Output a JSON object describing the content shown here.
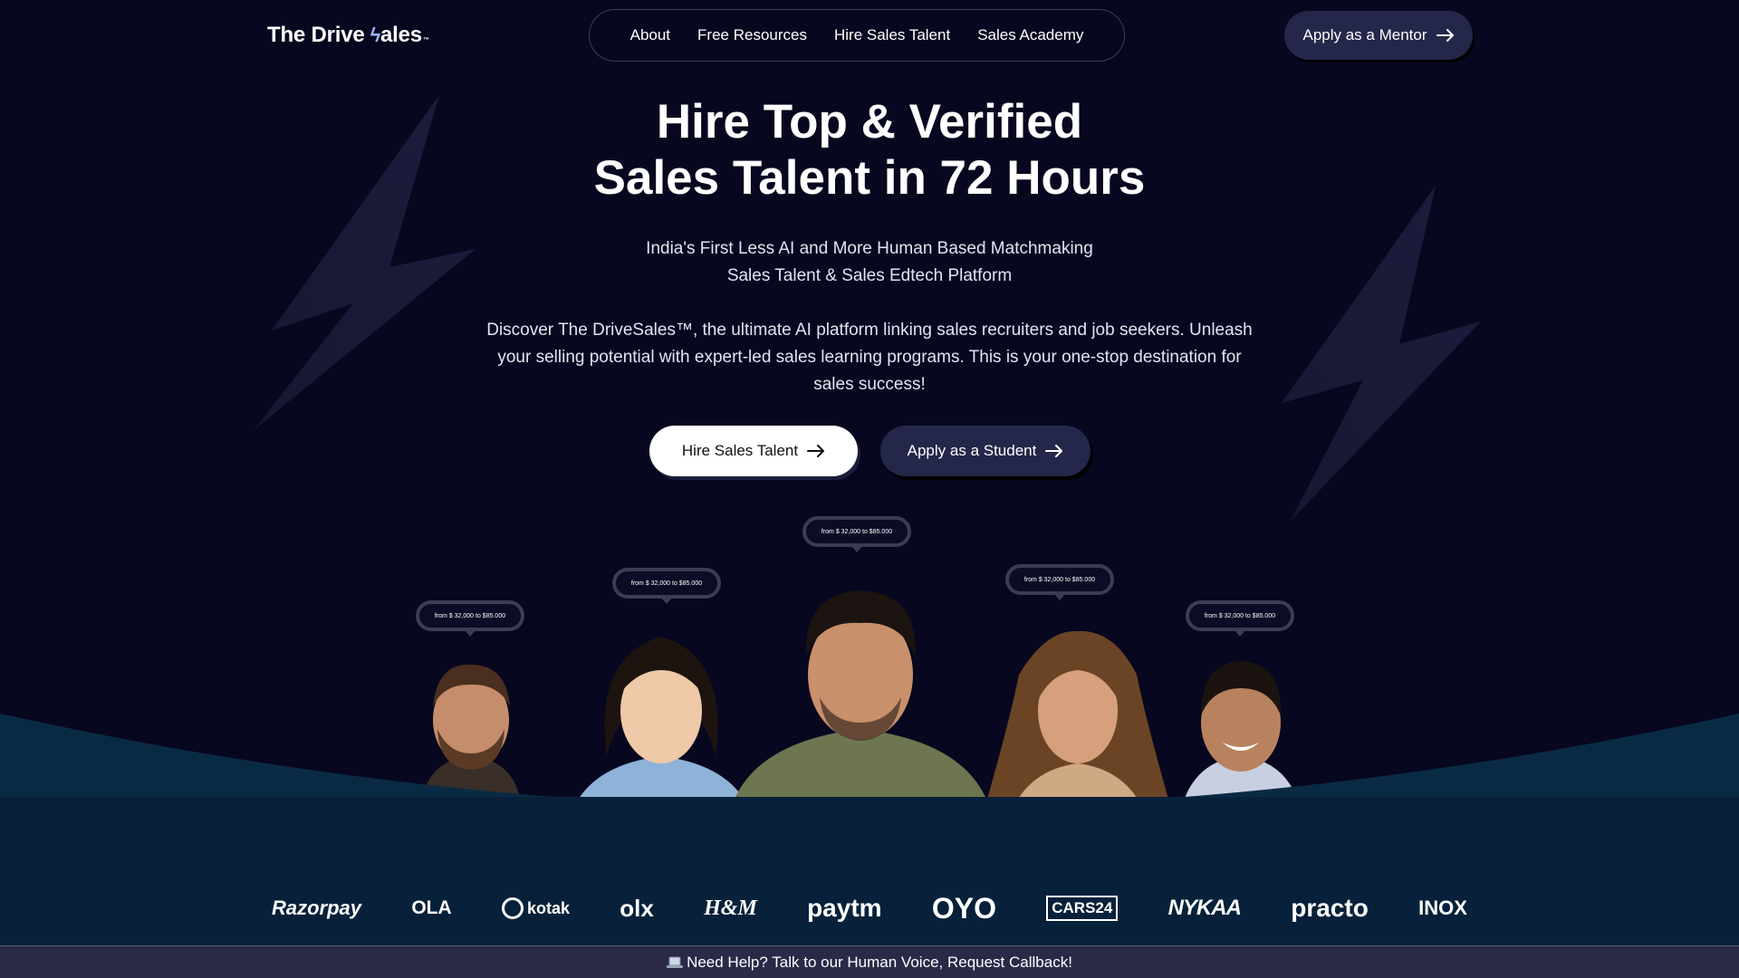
{
  "header": {
    "logo_text_1": "The Drive",
    "logo_text_2": "ales",
    "logo_tm": "™",
    "nav": [
      "About",
      "Free Resources",
      "Hire Sales Talent",
      "Sales Academy"
    ],
    "cta_label": "Apply as a Mentor"
  },
  "hero": {
    "title_line_1": "Hire Top & Verified",
    "title_line_2": "Sales Talent in 72 Hours",
    "subtitle_line_1": "India's First Less AI and More Human Based Matchmaking",
    "subtitle_line_2": "Sales Talent & Sales Edtech Platform",
    "description": "Discover The DriveSales™, the ultimate AI platform linking sales recruiters and job seekers. Unleash your selling potential with expert-led sales learning programs. This is your one-stop destination for sales success!",
    "primary_button": "Hire Sales Talent",
    "secondary_button": "Apply as a Student"
  },
  "talent_cards": [
    {
      "salary": "from $ 32,000 to $85.000"
    },
    {
      "salary": "from $ 32,000 to $85.000"
    },
    {
      "salary": "from $ 32,000 to $85.000"
    },
    {
      "salary": "from $ 32,000 to $85.000"
    },
    {
      "salary": "from $ 32,000 to $85.000"
    }
  ],
  "client_logos": [
    "Razorpay",
    "OLA",
    "kotak",
    "olx",
    "H&M",
    "paytm",
    "OYO",
    "CARS24",
    "NYKAA",
    "practo",
    "INOX"
  ],
  "help_bar": {
    "icon": "laptop-icon",
    "text": "Need Help? Talk to our Human Voice, Request Callback!"
  },
  "colors": {
    "background": "#07071f",
    "button_dark": "#25274a",
    "curve": "#0a2a44"
  }
}
